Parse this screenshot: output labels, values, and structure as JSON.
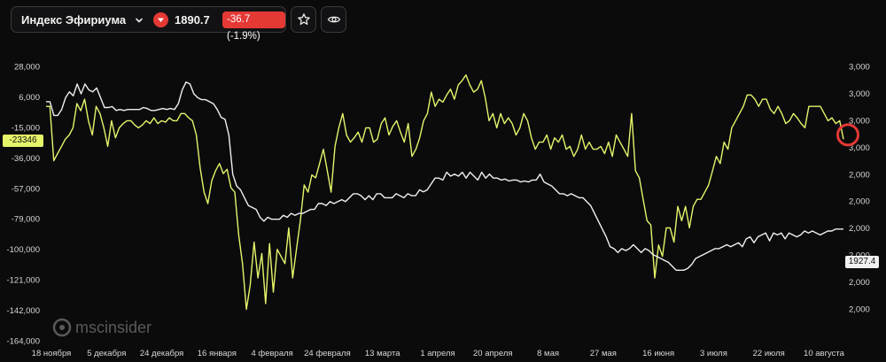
{
  "header": {
    "instrument": "Индекс Эфириума",
    "price": "1890.7",
    "change": "-36.7 (-1.9%)",
    "icons": [
      "chevron-down-icon",
      "down-triangle-icon",
      "star-icon",
      "eye-icon"
    ]
  },
  "colors": {
    "background": "#0b0b0c",
    "lime_series": "#e6f46a",
    "white_series": "#f0f0f0",
    "negative": "#e53935",
    "marker": "#e53935"
  },
  "watermark": {
    "text": "mscinsider"
  },
  "chart_data": {
    "type": "line",
    "x": {
      "tick_labels": [
        "18 ноября",
        "5 декабря",
        "24 декабря",
        "16 января",
        "4 февраля",
        "24 февраля",
        "13 марта",
        "1 апреля",
        "20 апреля",
        "8 мая",
        "27 мая",
        "16 июня",
        "3 июля",
        "22 июля",
        "10 августа"
      ]
    },
    "y_left": {
      "tick_labels": [
        "28,000",
        "6,000",
        "-15,000",
        "-36,000",
        "-57,000",
        "-79,000",
        "-100,000",
        "-121,000",
        "-142,000",
        "-164,000"
      ],
      "range": [
        -164000,
        28000
      ]
    },
    "y_right": {
      "tick_labels": [
        "3,000",
        "3,000",
        "3,000",
        "3,000",
        "2,000",
        "2,000",
        "2,000",
        "2,000",
        "2,000",
        "2,000"
      ],
      "range": [
        1750,
        3150
      ]
    },
    "current_labels": {
      "left": "-23346",
      "right": "1927.4"
    },
    "series": [
      {
        "axis": "left",
        "color": "#e6f46a",
        "values": [
          0,
          0,
          -38,
          -33,
          -28,
          -23,
          -20,
          -15,
          2,
          -3,
          5,
          -10,
          -20,
          0,
          -5,
          -15,
          -28,
          -10,
          -22,
          -15,
          -12,
          -10,
          -10,
          -13,
          -15,
          -13,
          -10,
          -12,
          -8,
          -12,
          -10,
          -11,
          -8,
          -10,
          -10,
          -5,
          -5,
          -8,
          -10,
          -20,
          -43,
          -60,
          -68,
          -52,
          -45,
          -40,
          -47,
          -44,
          -57,
          -60,
          -90,
          -110,
          -142,
          -125,
          -95,
          -120,
          -103,
          -138,
          -96,
          -130,
          -100,
          -105,
          -110,
          -85,
          -120,
          -100,
          -80,
          -55,
          -60,
          -48,
          -50,
          -40,
          -30,
          -45,
          -60,
          -28,
          -15,
          -5,
          -20,
          -25,
          -22,
          -18,
          -25,
          -15,
          -15,
          -25,
          -23,
          -12,
          -8,
          -20,
          -14,
          -10,
          -18,
          -25,
          -12,
          -35,
          -30,
          -22,
          -10,
          -5,
          10,
          0,
          5,
          3,
          8,
          12,
          5,
          15,
          18,
          22,
          15,
          10,
          12,
          18,
          6,
          -10,
          -5,
          -15,
          -5,
          -12,
          -8,
          -12,
          -20,
          -15,
          -5,
          -10,
          -22,
          -30,
          -25,
          -25,
          -20,
          -30,
          -22,
          -25,
          -20,
          -30,
          -28,
          -35,
          -30,
          -20,
          -30,
          -25,
          -30,
          -30,
          -28,
          -33,
          -25,
          -35,
          -20,
          -25,
          -30,
          -35,
          -5,
          -45,
          -50,
          -65,
          -80,
          -83,
          -120,
          -97,
          -105,
          -85,
          -85,
          -95,
          -70,
          -80,
          -70,
          -85,
          -70,
          -65,
          -65,
          -60,
          -55,
          -45,
          -35,
          -40,
          -25,
          -30,
          -15,
          -10,
          -5,
          0,
          8,
          8,
          5,
          0,
          5,
          5,
          -2,
          -5,
          0,
          -5,
          -12,
          -10,
          -5,
          -8,
          -12,
          -15,
          0,
          0,
          0,
          0,
          -5,
          -10,
          -8,
          -12,
          -10,
          -23
        ]
      },
      {
        "axis": "right",
        "color": "#f0f0f0",
        "values": [
          2970,
          2970,
          2900,
          2900,
          2930,
          2990,
          3020,
          3000,
          3060,
          3010,
          3060,
          3030,
          3020,
          3040,
          2990,
          2940,
          2940,
          2945,
          2925,
          2930,
          2925,
          2930,
          2930,
          2930,
          2930,
          2940,
          2935,
          2925,
          2925,
          2930,
          2935,
          2930,
          2935,
          2930,
          2960,
          3030,
          3070,
          3060,
          3010,
          2990,
          2980,
          2980,
          2970,
          2960,
          2930,
          2890,
          2880,
          2800,
          2600,
          2540,
          2520,
          2480,
          2440,
          2430,
          2420,
          2380,
          2360,
          2380,
          2370,
          2370,
          2370,
          2390,
          2380,
          2400,
          2390,
          2400,
          2400,
          2410,
          2420,
          2420,
          2450,
          2450,
          2440,
          2460,
          2450,
          2460,
          2470,
          2460,
          2480,
          2500,
          2500,
          2490,
          2470,
          2490,
          2470,
          2500,
          2500,
          2480,
          2480,
          2480,
          2500,
          2490,
          2480,
          2500,
          2490,
          2490,
          2520,
          2510,
          2520,
          2550,
          2580,
          2580,
          2570,
          2610,
          2590,
          2600,
          2590,
          2610,
          2580,
          2610,
          2590,
          2570,
          2610,
          2580,
          2600,
          2580,
          2580,
          2570,
          2575,
          2565,
          2570,
          2570,
          2560,
          2565,
          2560,
          2570,
          2570,
          2600,
          2560,
          2550,
          2540,
          2520,
          2500,
          2500,
          2490,
          2500,
          2490,
          2480,
          2480,
          2460,
          2440,
          2400,
          2360,
          2320,
          2280,
          2230,
          2220,
          2200,
          2220,
          2210,
          2220,
          2240,
          2220,
          2200,
          2220,
          2210,
          2190,
          2180,
          2170,
          2160,
          2150,
          2130,
          2110,
          2110,
          2110,
          2120,
          2140,
          2170,
          2180,
          2190,
          2200,
          2210,
          2220,
          2220,
          2230,
          2240,
          2230,
          2240,
          2250,
          2230,
          2270,
          2280,
          2250,
          2280,
          2290,
          2300,
          2260,
          2300,
          2290,
          2300,
          2270,
          2300,
          2290,
          2280,
          2290,
          2310,
          2300,
          2310,
          2300,
          2290,
          2300,
          2310,
          2310,
          2320,
          2320,
          2320
        ]
      }
    ],
    "highlight": {
      "series_index": 0,
      "point": "last",
      "color": "#e53935"
    },
    "grid": false,
    "legend": "none"
  }
}
